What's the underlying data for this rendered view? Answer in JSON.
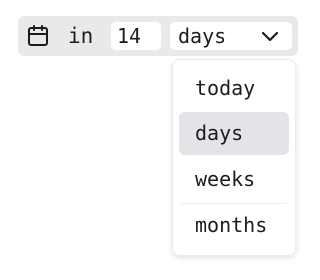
{
  "toolbar": {
    "calendar_icon": "calendar-icon",
    "in_label": "in",
    "number_value": "14",
    "unit_selected": "days",
    "chevron_icon": "chevron-down-icon"
  },
  "dropdown": {
    "options": [
      {
        "label": "today",
        "selected": false
      },
      {
        "label": "days",
        "selected": true
      },
      {
        "label": "weeks",
        "selected": false
      },
      {
        "label": "months",
        "selected": false
      }
    ]
  },
  "colors": {
    "toolbar_bg": "#e9e9ec",
    "selected_bg": "#e4e4e8",
    "text": "#1c1c1e"
  }
}
